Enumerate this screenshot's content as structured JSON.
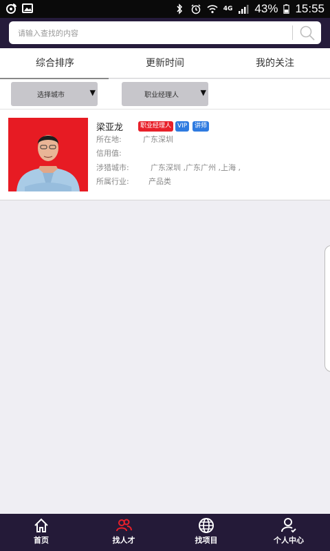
{
  "status_bar": {
    "battery": "43%",
    "time": "15:55",
    "network": "4G",
    "icons": [
      "weibo-icon",
      "image-icon",
      "bluetooth-icon",
      "alarm-icon",
      "wifi-icon",
      "signal-icon",
      "battery-icon"
    ]
  },
  "search": {
    "placeholder": "请输入查找的内容",
    "icon": "search-icon"
  },
  "tabs": [
    {
      "label": "综合排序",
      "active": true
    },
    {
      "label": "更新时间",
      "active": false
    },
    {
      "label": "我的关注",
      "active": false
    }
  ],
  "filters": {
    "city": {
      "label": "选择城市"
    },
    "role": {
      "label": "职业经理人"
    }
  },
  "candidate": {
    "name": "梁亚龙",
    "tags": [
      "职业经理人",
      "VIP",
      "讲师"
    ],
    "location_label": "所在地:",
    "location_value": "广东深圳",
    "credit_label": "信用值:",
    "credit_value": "",
    "cities_label": "涉猎城市:",
    "cities_value": "广东深圳 ,广东广州 ,上海 ,",
    "industry_label": "所属行业:",
    "industry_value": "产品类"
  },
  "nav": [
    {
      "label": "首页",
      "icon": "home-icon",
      "active": false
    },
    {
      "label": "找人才",
      "icon": "people-icon",
      "active": true
    },
    {
      "label": "找项目",
      "icon": "globe-icon",
      "active": false
    },
    {
      "label": "个人中心",
      "icon": "user-icon",
      "active": false
    }
  ],
  "colors": {
    "accent": "#e8202a",
    "header_bg": "#251b3b",
    "vip_blue": "#2f7be0"
  }
}
